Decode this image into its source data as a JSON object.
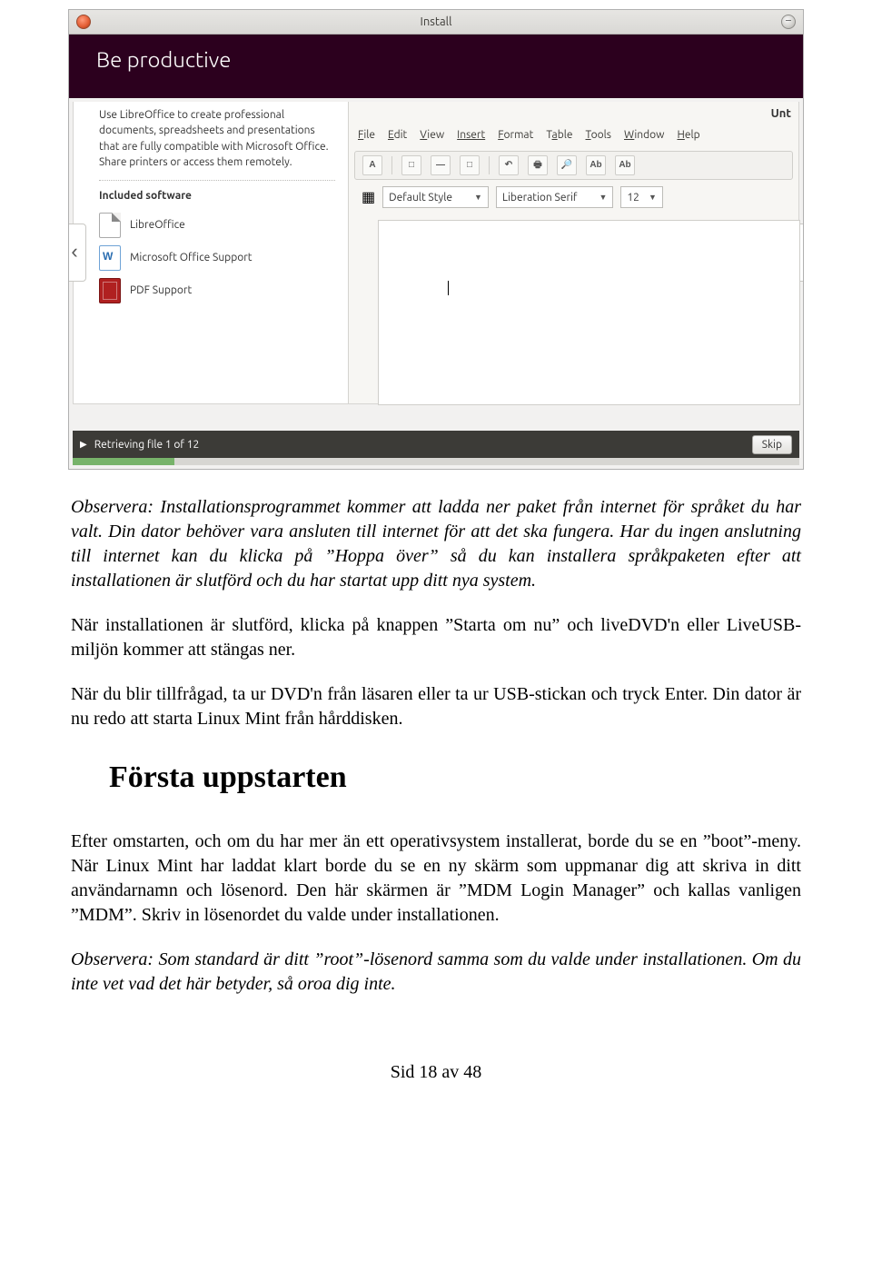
{
  "screenshot": {
    "window_title": "Install",
    "hero": "Be productive",
    "desc": "Use LibreOffice to create professional documents, spreadsheets and presentations that are fully compatible with Microsoft Office. Share printers or access them remotely.",
    "included_heading": "Included software",
    "software": {
      "libreoffice": "LibreOffice",
      "msoffice": "Microsoft Office Support",
      "pdf": "PDF Support"
    },
    "doc_title": "Unt",
    "menu": {
      "file": "File",
      "edit": "Edit",
      "view": "View",
      "insert": "Insert",
      "format": "Format",
      "table": "Table",
      "tools": "Tools",
      "window": "Window",
      "help": "Help"
    },
    "style_combo": "Default Style",
    "font_combo": "Liberation Serif",
    "size_combo": "12",
    "progress_text": "Retrieving file 1 of 12",
    "skip": "Skip"
  },
  "body": {
    "p1": "Observera: Installationsprogrammet kommer att ladda ner paket från internet för språket du har valt. Din dator behöver vara ansluten till internet för att det ska fungera. Har du ingen anslutning till internet kan du klicka på ”Hoppa över” så du kan installera språkpaketen efter att installationen är slutförd och du har startat upp ditt nya system.",
    "p2": "När installationen är slutförd, klicka på knappen ”Starta om nu” och liveDVD'n eller LiveUSB-miljön kommer att stängas ner.",
    "p3": "När du blir tillfrågad, ta ur DVD'n från läsaren eller ta ur USB-stickan och tryck Enter. Din dator är nu redo att starta Linux Mint från hårddisken.",
    "h2": "Första uppstarten",
    "p4": "Efter omstarten, och om du har mer än ett operativsystem installerat, borde du se en ”boot”-meny. När Linux Mint har laddat klart borde du se en ny skärm som uppmanar dig att skriva in ditt användarnamn och lösenord. Den här skärmen är ”MDM Login Manager” och kallas vanligen ”MDM”. Skriv in lösenordet du valde under installationen.",
    "p5": "Observera: Som standard är ditt ”root”-lösenord samma som du valde under installationen. Om du inte vet vad det här betyder, så oroa dig inte."
  },
  "footer": "Sid 18 av 48"
}
